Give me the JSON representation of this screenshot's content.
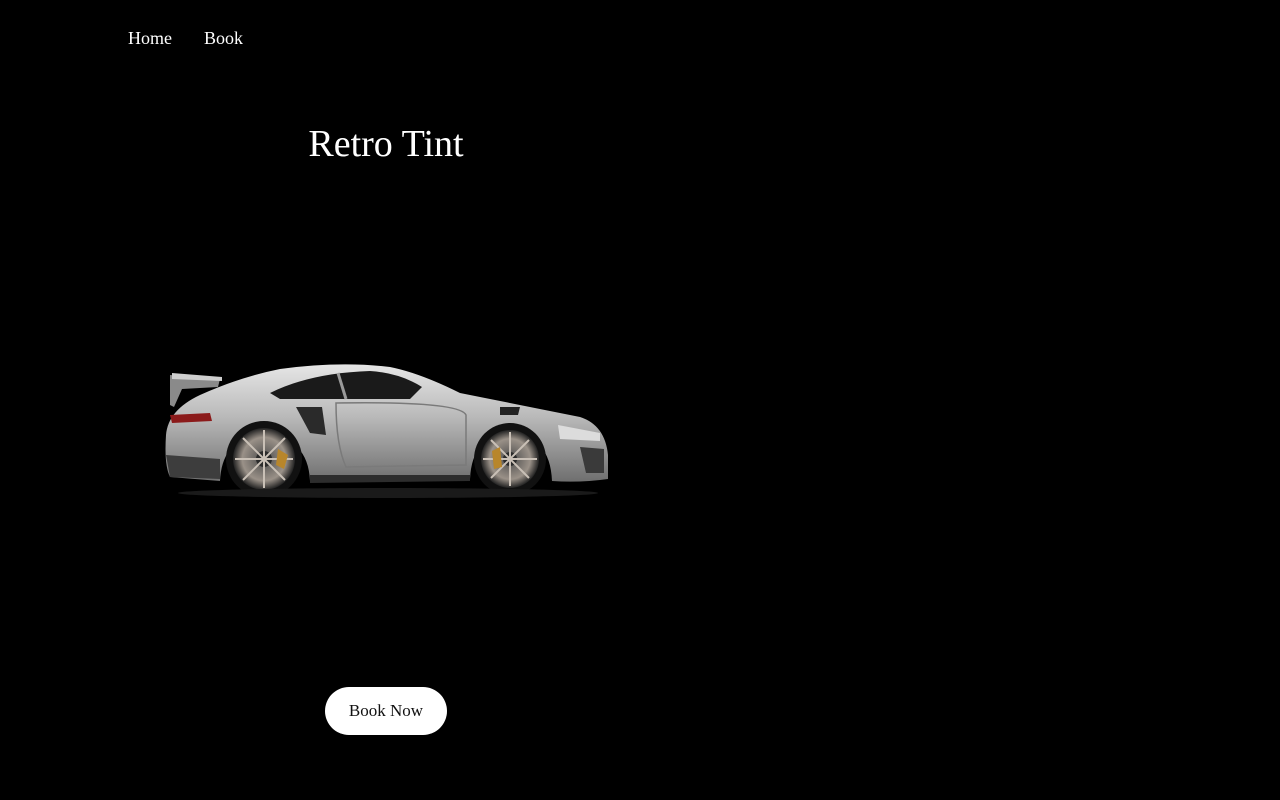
{
  "nav": {
    "items": [
      {
        "label": "Home"
      },
      {
        "label": "Book"
      }
    ]
  },
  "hero": {
    "title": "Retro Tint",
    "cta_label": "Book Now",
    "image": {
      "icon": "sports-car-image"
    }
  },
  "colors": {
    "background": "#000000",
    "text": "#ffffff",
    "button_bg": "#ffffff",
    "button_text": "#111111"
  }
}
